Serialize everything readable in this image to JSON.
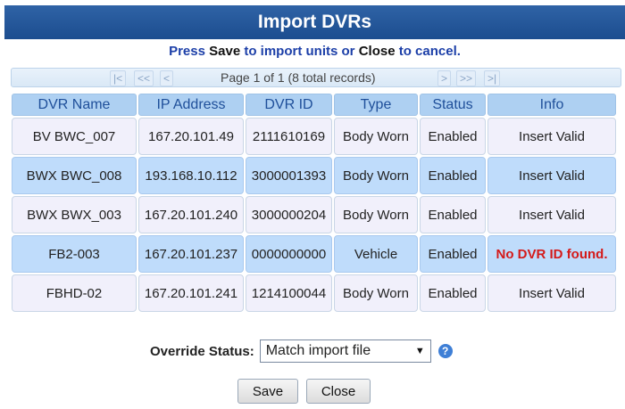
{
  "dialog": {
    "title": "Import DVRs",
    "instruction": {
      "p1": "Press ",
      "save": "Save",
      "p2": " to import units or ",
      "close": "Close",
      "p3": " to cancel."
    }
  },
  "pager": {
    "first": "|<",
    "prev_page": "<<",
    "prev": "<",
    "info": "Page 1 of 1 (8 total records)",
    "next": ">",
    "next_page": ">>",
    "last": ">|"
  },
  "table": {
    "headers": [
      "DVR Name",
      "IP Address",
      "DVR ID",
      "Type",
      "Status",
      "Info"
    ],
    "rows": [
      [
        "BV BWC_007",
        "167.20.101.49",
        "2111610169",
        "Body Worn",
        "Enabled",
        "Insert Valid"
      ],
      [
        "BWX BWC_008",
        "193.168.10.112",
        "3000001393",
        "Body Worn",
        "Enabled",
        "Insert Valid"
      ],
      [
        "BWX BWX_003",
        "167.20.101.240",
        "3000000204",
        "Body Worn",
        "Enabled",
        "Insert Valid"
      ],
      [
        "FB2-003",
        "167.20.101.237",
        "0000000000",
        "Vehicle",
        "Enabled",
        "No DVR ID found."
      ],
      [
        "FBHD-02",
        "167.20.101.241",
        "1214100044",
        "Body Worn",
        "Enabled",
        "Insert Valid"
      ]
    ]
  },
  "override": {
    "label": "Override Status:",
    "selected": "Match import file",
    "help": "?"
  },
  "buttons": {
    "save": "Save",
    "close": "Close"
  },
  "colors": {
    "title_bar": "#1c4d8f",
    "header_cell": "#aed0f2",
    "highlight_row": "#bfdcfb",
    "error_text": "#d41a1a"
  },
  "icons": {
    "help": "help-icon",
    "dropdown": "caret-down-icon"
  }
}
